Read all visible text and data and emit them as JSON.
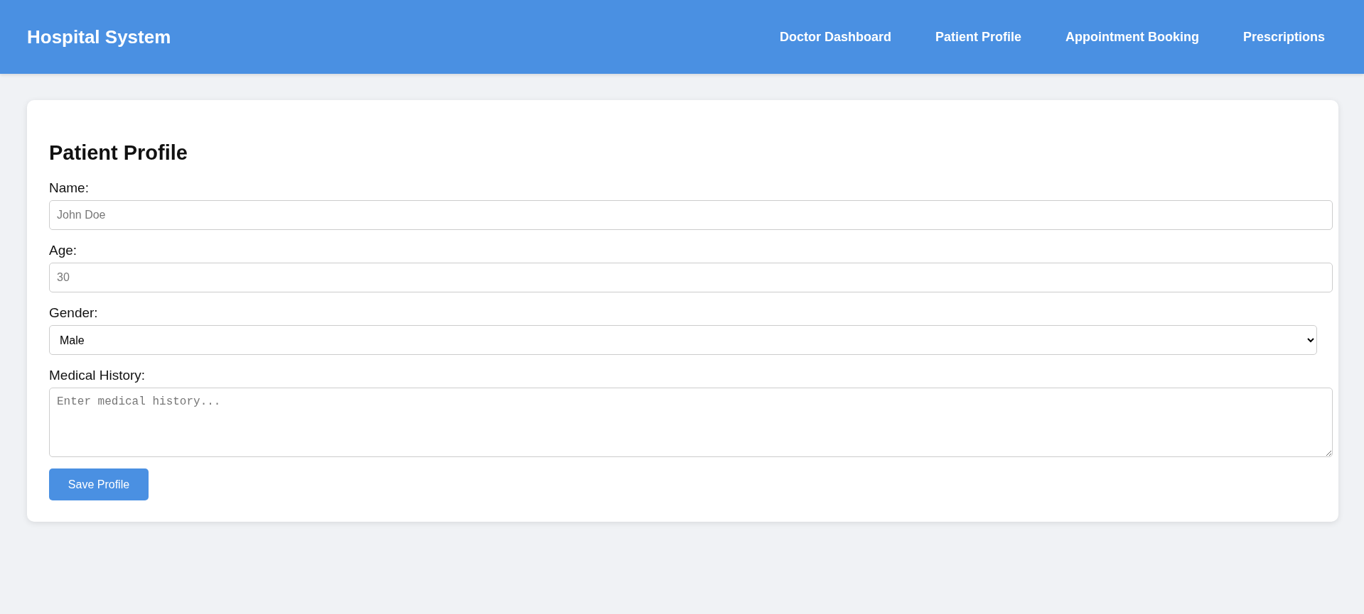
{
  "header": {
    "title": "Hospital System",
    "nav": [
      {
        "label": "Doctor Dashboard"
      },
      {
        "label": "Patient Profile"
      },
      {
        "label": "Appointment Booking"
      },
      {
        "label": "Prescriptions"
      }
    ]
  },
  "profile": {
    "heading": "Patient Profile",
    "fields": [
      {
        "kind": "text",
        "label": "Name:",
        "placeholder": "John Doe"
      },
      {
        "kind": "text",
        "label": "Age:",
        "placeholder": "30"
      },
      {
        "kind": "select",
        "label": "Gender:",
        "value": "Male"
      },
      {
        "kind": "textarea",
        "label": "Medical History:",
        "placeholder": "Enter medical history..."
      }
    ],
    "button": "Save Profile"
  }
}
